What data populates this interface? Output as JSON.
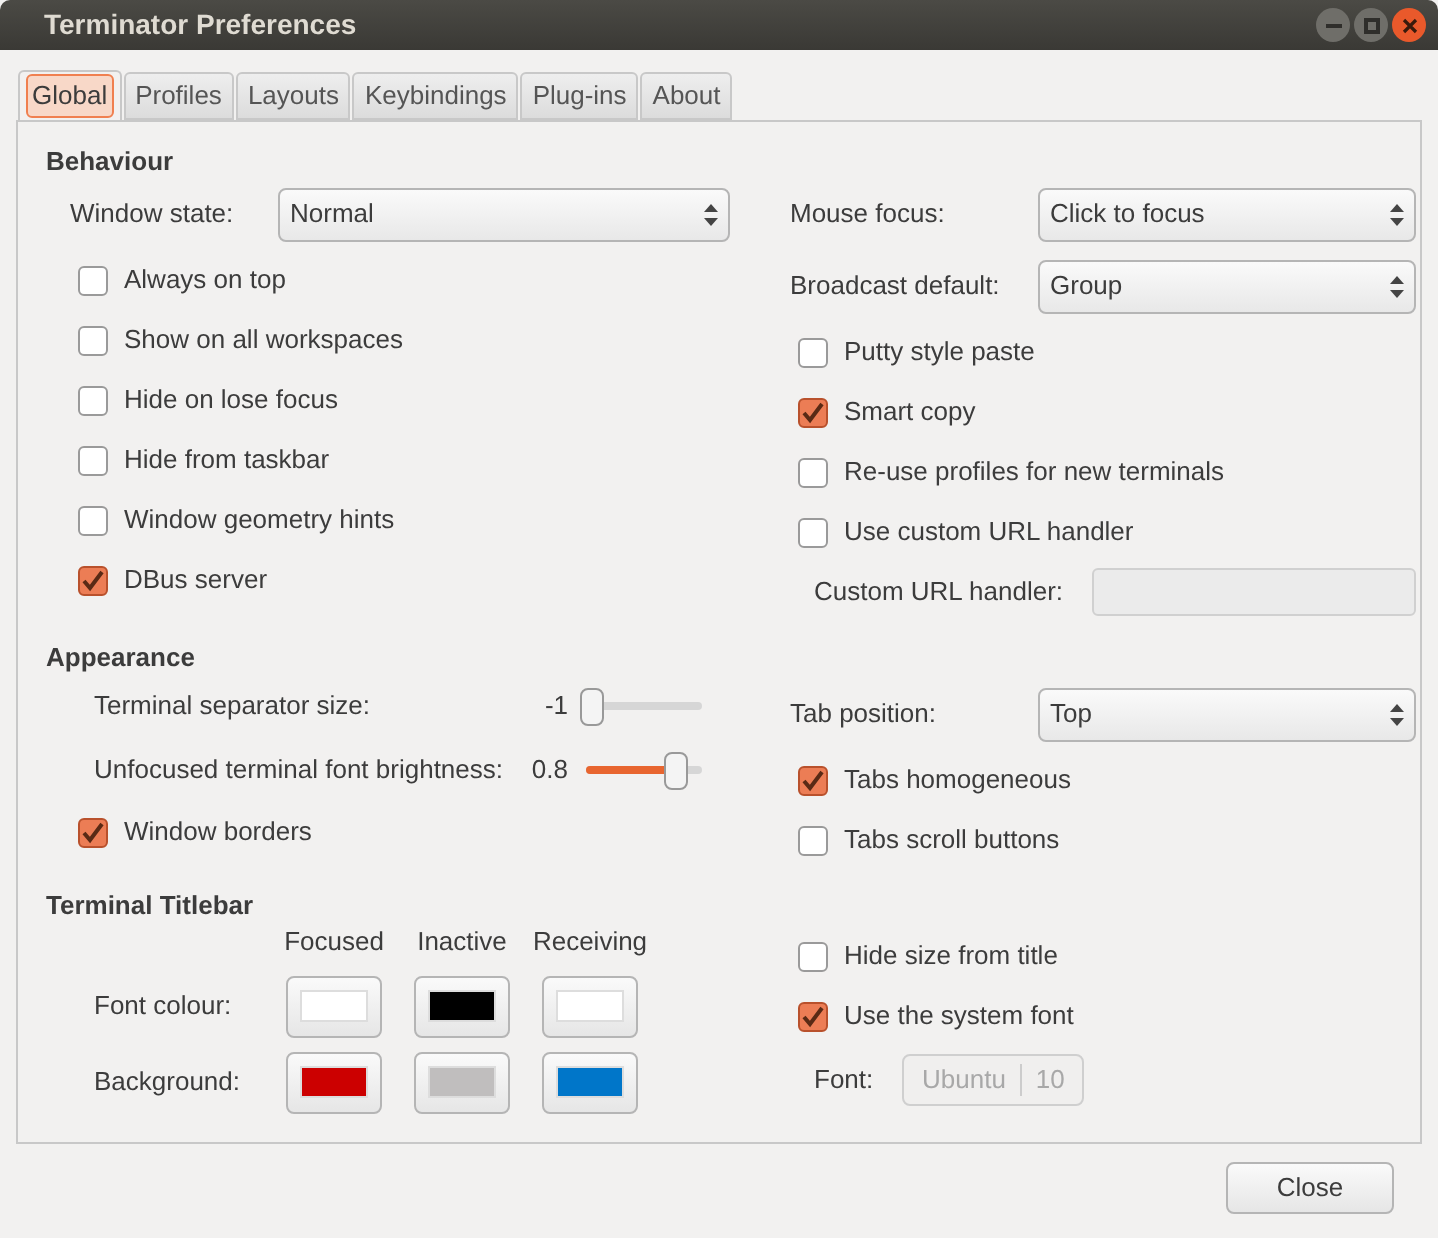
{
  "window": {
    "title": "Terminator Preferences"
  },
  "tabs": [
    {
      "label": "Global",
      "selected": true
    },
    {
      "label": "Profiles",
      "selected": false
    },
    {
      "label": "Layouts",
      "selected": false
    },
    {
      "label": "Keybindings",
      "selected": false
    },
    {
      "label": "Plug-ins",
      "selected": false
    },
    {
      "label": "About",
      "selected": false
    }
  ],
  "sections": [
    {
      "heading": "Behaviour",
      "left": [
        {
          "kind": "select",
          "label": "Window state:",
          "value": "Normal"
        },
        {
          "kind": "check",
          "label": "Always on top",
          "checked": false
        },
        {
          "kind": "check",
          "label": "Show on all workspaces",
          "checked": false
        },
        {
          "kind": "check",
          "label": "Hide on lose focus",
          "checked": false
        },
        {
          "kind": "check",
          "label": "Hide from taskbar",
          "checked": false
        },
        {
          "kind": "check",
          "label": "Window geometry hints",
          "checked": false
        },
        {
          "kind": "check",
          "label": "DBus server",
          "checked": true
        }
      ],
      "right": [
        {
          "kind": "select",
          "label": "Mouse focus:",
          "value": "Click to focus"
        },
        {
          "kind": "select",
          "label": "Broadcast default:",
          "value": "Group"
        },
        {
          "kind": "check",
          "label": "Putty style paste",
          "checked": false
        },
        {
          "kind": "check",
          "label": "Smart copy",
          "checked": true
        },
        {
          "kind": "check",
          "label": "Re-use profiles for new terminals",
          "checked": false
        },
        {
          "kind": "check",
          "label": "Use custom URL handler",
          "checked": false
        },
        {
          "kind": "field",
          "label": "Custom URL handler:",
          "disabled": true
        }
      ]
    },
    {
      "heading": "Appearance",
      "left": [
        {
          "kind": "slider",
          "label": "Terminal separator size:",
          "reading": "-1",
          "level": 0
        },
        {
          "kind": "slider",
          "label": "Unfocused terminal font brightness:",
          "reading": "0.8",
          "level": 0.8
        },
        {
          "kind": "check",
          "label": "Window borders",
          "checked": true
        }
      ],
      "right": [
        {
          "kind": "select",
          "label": "Tab position:",
          "value": "Top"
        },
        {
          "kind": "check",
          "label": "Tabs homogeneous",
          "checked": true
        },
        {
          "kind": "check",
          "label": "Tabs scroll buttons",
          "checked": false
        }
      ]
    },
    {
      "heading": "Terminal Titlebar",
      "left": [
        {
          "kind": "colors",
          "columns": [
            "Focused",
            "Inactive",
            "Receiving"
          ],
          "rows": [
            {
              "label": "Font colour:",
              "swatches": [
                {
                  "color": "#ffffff"
                },
                {
                  "color": "#000000"
                },
                {
                  "color": "#ffffff"
                }
              ]
            },
            {
              "label": "Background:",
              "swatches": [
                {
                  "color": "#cc0000"
                },
                {
                  "color": "#c0bebe"
                },
                {
                  "color": "#0076c9"
                }
              ]
            }
          ]
        }
      ],
      "right": [
        {
          "kind": "check",
          "label": "Hide size from title",
          "checked": false
        },
        {
          "kind": "check",
          "label": "Use the system font",
          "checked": true
        },
        {
          "kind": "font",
          "label": "Font:",
          "name": "Ubuntu",
          "size": "10",
          "disabled": true
        }
      ]
    }
  ],
  "buttons": [
    {
      "label": "Close"
    }
  ]
}
